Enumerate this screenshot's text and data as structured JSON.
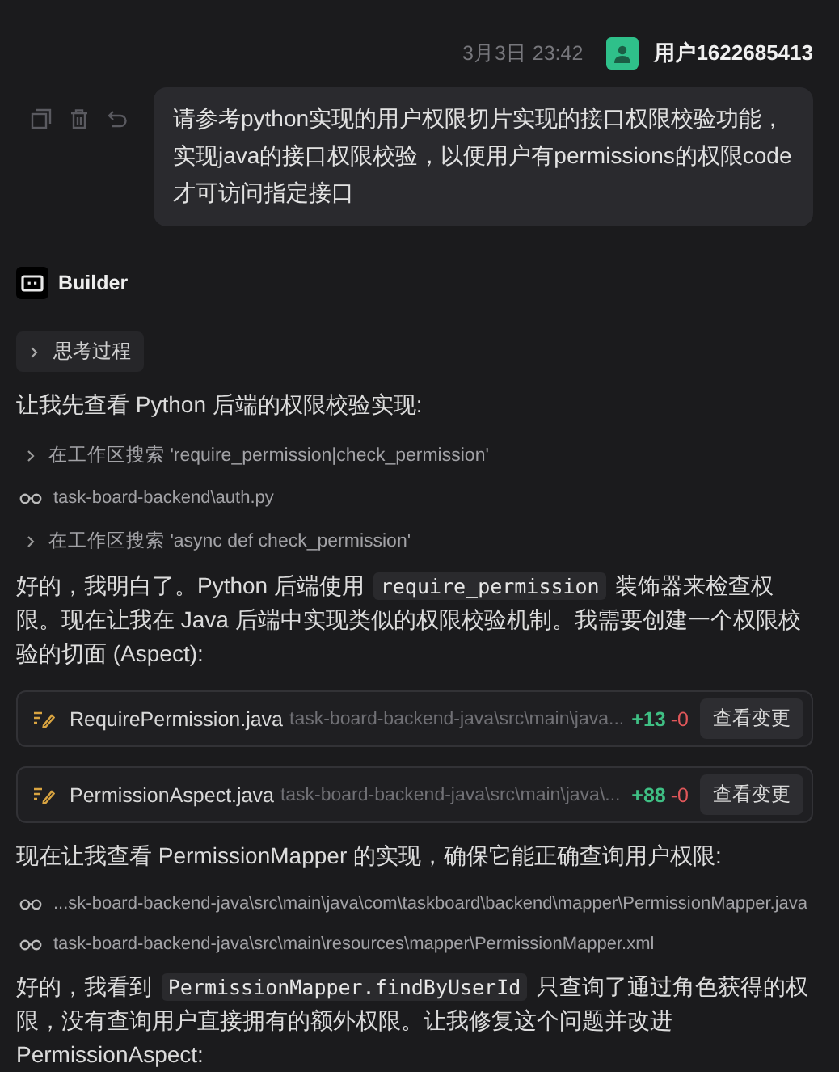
{
  "user_message": {
    "time": "3月3日 23:42",
    "user": "用户1622685413",
    "text": "请参考python实现的用户权限切片实现的接口权限校验功能，实现java的接口权限校验，以便用户有permissions的权限code才可访问指定接口"
  },
  "assistant": {
    "name": "Builder",
    "thinking": {
      "label": "思考过程",
      "expanded": false
    },
    "blocks": [
      {
        "kind": "text",
        "parts": [
          {
            "text": "让我先查看 Python 后端的权限校验实现:"
          }
        ]
      },
      {
        "kind": "search",
        "text": "在工作区搜索 'require_permission|check_permission'"
      },
      {
        "kind": "file",
        "text": "task-board-backend\\auth.py"
      },
      {
        "kind": "search",
        "text": "在工作区搜索 'async def check_permission'"
      },
      {
        "kind": "text",
        "parts": [
          {
            "text": "好的，我明白了。Python 后端使用 "
          },
          {
            "code": "require_permission"
          },
          {
            "text": " 装饰器来检查权限。现在让我在 Java 后端中实现类似的权限校验机制。我需要创建一个权限校验的切面 (Aspect):"
          }
        ]
      },
      {
        "kind": "change",
        "file": "RequirePermission.java",
        "path": "task-board-backend-java\\src\\main\\java...",
        "added": "+13",
        "removed": "-0",
        "button": "查看变更"
      },
      {
        "kind": "change",
        "file": "PermissionAspect.java",
        "path": "task-board-backend-java\\src\\main\\java\\...",
        "added": "+88",
        "removed": "-0",
        "button": "查看变更"
      },
      {
        "kind": "text",
        "parts": [
          {
            "text": "现在让我查看 PermissionMapper 的实现，确保它能正确查询用户权限:"
          }
        ]
      },
      {
        "kind": "file",
        "text": "...sk-board-backend-java\\src\\main\\java\\com\\taskboard\\backend\\mapper\\PermissionMapper.java"
      },
      {
        "kind": "file",
        "text": "task-board-backend-java\\src\\main\\resources\\mapper\\PermissionMapper.xml"
      },
      {
        "kind": "text",
        "parts": [
          {
            "text": "好的，我看到 "
          },
          {
            "code": "PermissionMapper.findByUserId"
          },
          {
            "text": " 只查询了通过角色获得的权限，没有查询用户直接拥有的额外权限。让我修复这个问题并改进 PermissionAspect:"
          }
        ]
      }
    ]
  }
}
